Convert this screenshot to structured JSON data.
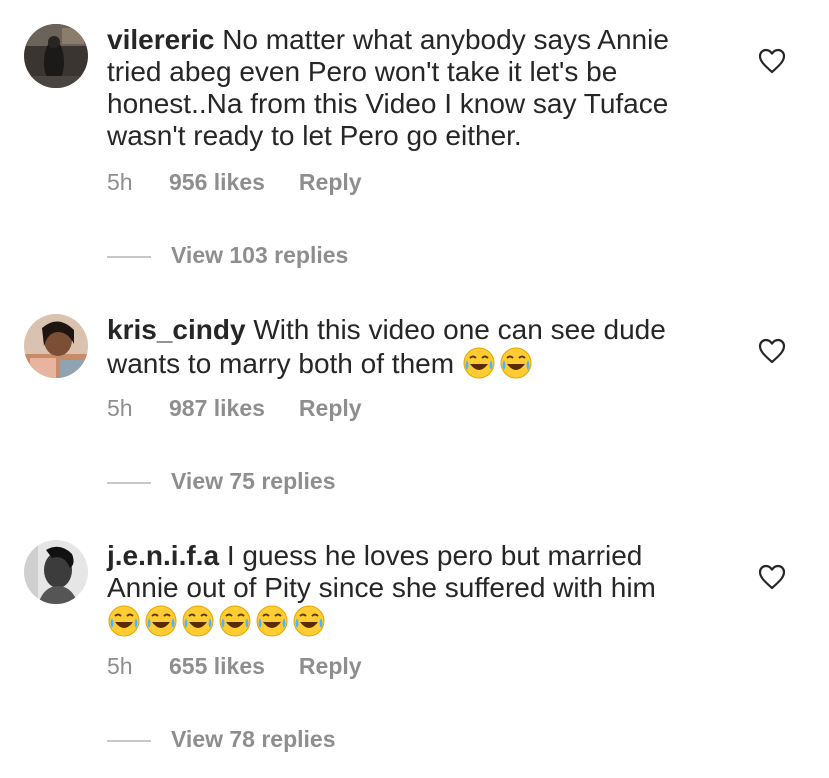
{
  "comments": [
    {
      "username": "vilereric",
      "text_lines": [
        "No matter what anybody says Annie",
        "tried abeg even Pero won't take it let's be",
        "honest..Na from this Video I know say Tuface",
        "wasn't ready to let Pero go either."
      ],
      "emojis": [],
      "time": "5h",
      "likes": "956 likes",
      "reply_label": "Reply",
      "view_replies": "View 103 replies",
      "avatar_icon": "profile-photo-dark"
    },
    {
      "username": "kris_cindy",
      "text_lines": [
        "With this video one can see dude",
        "wants to marry both of them"
      ],
      "emojis": [
        "face-with-tears-of-joy",
        "face-with-tears-of-joy"
      ],
      "time": "5h",
      "likes": "987 likes",
      "reply_label": "Reply",
      "view_replies": "View 75 replies",
      "avatar_icon": "profile-photo-woman"
    },
    {
      "username": "j.e.n.i.f.a",
      "text_lines": [
        "I guess he loves pero but married",
        "Annie out of Pity since she suffered with him"
      ],
      "emojis": [
        "face-with-tears-of-joy",
        "face-with-tears-of-joy",
        "face-with-tears-of-joy",
        "face-with-tears-of-joy",
        "face-with-tears-of-joy",
        "face-with-tears-of-joy"
      ],
      "time": "5h",
      "likes": "655 likes",
      "reply_label": "Reply",
      "view_replies": "View 78 replies",
      "avatar_icon": "profile-photo-grayscale"
    }
  ],
  "icons": {
    "like": "heart-outline-icon"
  },
  "colors": {
    "text": "#262626",
    "secondary": "#8e8e8e",
    "divider": "#c7c7c7"
  }
}
